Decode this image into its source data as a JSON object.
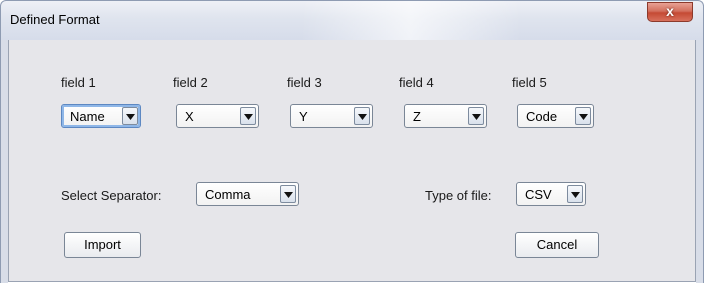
{
  "window": {
    "title": "Defined Format",
    "close_label": "x"
  },
  "fields": [
    {
      "label": "field 1",
      "value": "Name"
    },
    {
      "label": "field 2",
      "value": "X"
    },
    {
      "label": "field 3",
      "value": "Y"
    },
    {
      "label": "field 4",
      "value": "Z"
    },
    {
      "label": "field 5",
      "value": "Code"
    }
  ],
  "separator": {
    "label": "Select Separator:",
    "value": "Comma"
  },
  "file_type": {
    "label": "Type of file:",
    "value": "CSV"
  },
  "buttons": {
    "import": "Import",
    "cancel": "Cancel"
  },
  "icons": {
    "dropdown": "triangle-down-icon",
    "close": "close-icon"
  }
}
